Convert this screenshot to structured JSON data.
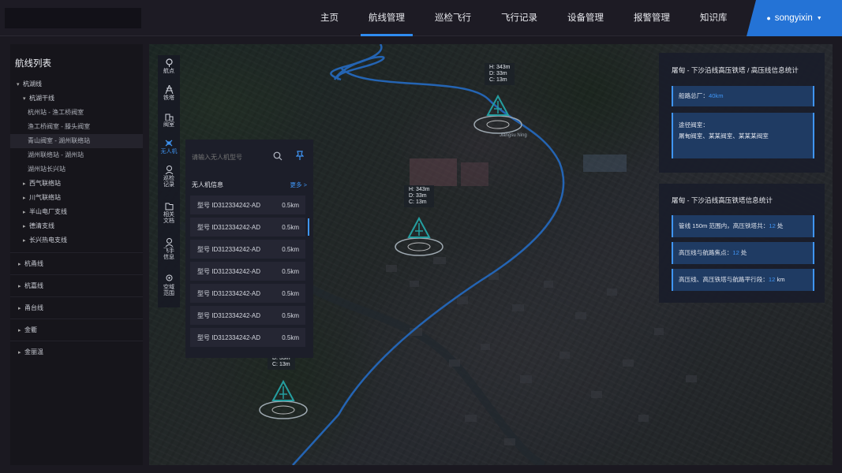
{
  "header": {
    "nav": [
      "主页",
      "航线管理",
      "巡检飞行",
      "飞行记录",
      "设备管理",
      "报警管理",
      "知识库"
    ],
    "active_nav": "航线管理",
    "user": "songyixin"
  },
  "sidebar": {
    "title": "航线列表",
    "tree": {
      "root": "杭湖线",
      "sub": "杭湖干线",
      "leaves": [
        "杭州站 - 渔工桥阀室",
        "渔工桥阀室 - 滕头阀室",
        "青山阀室 - 湖州联络站",
        "湖州联络站 - 湖州站",
        "湖州站长兴站"
      ],
      "siblings": [
        "西气联络站",
        "川气联络站",
        "半山电厂支线",
        "德清支线",
        "长兴热电支线"
      ],
      "groups": [
        "杭甬线",
        "杭嘉线",
        "甬台线",
        "金衢",
        "金丽温"
      ]
    }
  },
  "toolbar": {
    "tools": [
      {
        "icon": "waypoint-icon",
        "label": "航点"
      },
      {
        "icon": "tower-icon",
        "label": "铁塔"
      },
      {
        "icon": "valve-room-icon",
        "label": "阀室"
      },
      {
        "icon": "drone-icon",
        "label": "无人机"
      },
      {
        "icon": "patrol-record-icon",
        "label": "巡检记录"
      },
      {
        "icon": "document-icon",
        "label": "相关文档"
      },
      {
        "icon": "pilot-icon",
        "label": "飞手信息"
      },
      {
        "icon": "airspace-icon",
        "label": "空域范围"
      }
    ],
    "active": "无人机"
  },
  "drone_panel": {
    "search_placeholder": "请输入无人机型号",
    "header": "无人机信息",
    "more": "更多 >",
    "rows": [
      {
        "model": "型号 ID312334242-AD",
        "distance": "0.5km"
      },
      {
        "model": "型号 ID312334242-AD",
        "distance": "0.5km"
      },
      {
        "model": "型号 ID312334242-AD",
        "distance": "0.5km"
      },
      {
        "model": "型号 ID312334242-AD",
        "distance": "0.5km"
      },
      {
        "model": "型号 ID312334242-AD",
        "distance": "0.5km"
      },
      {
        "model": "型号 ID312334242-AD",
        "distance": "0.5km"
      },
      {
        "model": "型号 ID312334242-AD",
        "distance": "0.5km"
      }
    ]
  },
  "stats1": {
    "title": "屠甸 - 下沙沿线高压铁塔 / 高压线信息统计",
    "line1_label": "船路总厂：",
    "line1_value": "40km",
    "line2_label": "途径阀室：",
    "line2_value": "屠甸阀室、某某阀室、某某某阀室"
  },
  "stats2": {
    "title": "屠甸 - 下沙沿线高压铁塔信息统计",
    "rows": [
      {
        "label": "管线 150m 范围内，高压铁塔共：",
        "value": "12",
        "unit": " 处"
      },
      {
        "label": "高压线与航路焦点：",
        "value": "12",
        "unit": " 处"
      },
      {
        "label": "高压线、高压铁塔与航路平行段：",
        "value": "12",
        "unit": " km"
      }
    ]
  },
  "markers": [
    {
      "h": "H:  343m",
      "d": "D:  33m",
      "c": "C:  13m",
      "caption": "Jiangsu Ning"
    },
    {
      "h": "H:  343m",
      "d": "D:  33m",
      "c": "C:  13m"
    },
    {
      "d": "D:  33m",
      "c": "C:  13m"
    }
  ],
  "colors": {
    "accent": "#2f8cf0",
    "route": "#2f86f0",
    "marker": "#2fd6d6"
  }
}
